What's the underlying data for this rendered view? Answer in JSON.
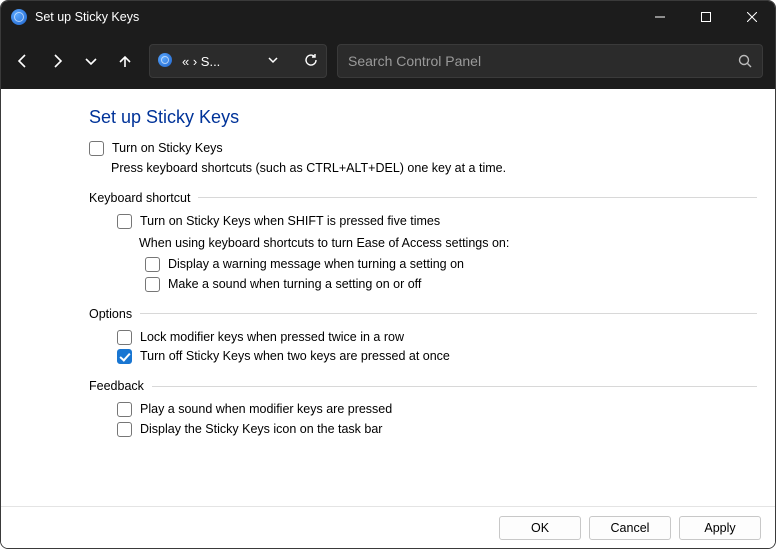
{
  "window": {
    "title": "Set up Sticky Keys"
  },
  "breadcrumb": {
    "trail": "«  ›  S...",
    "chevron_sep": "›"
  },
  "search": {
    "placeholder": "Search Control Panel"
  },
  "page": {
    "heading": "Set up Sticky Keys",
    "turn_on_label": "Turn on Sticky Keys",
    "turn_on_checked": false,
    "turn_on_desc": "Press keyboard shortcuts (such as CTRL+ALT+DEL) one key at a time."
  },
  "groups": {
    "keyboard_shortcut": {
      "title": "Keyboard shortcut",
      "shift5": {
        "label": "Turn on Sticky Keys when SHIFT is pressed five times",
        "checked": false
      },
      "intro": "When using keyboard shortcuts to turn Ease of Access settings on:",
      "warning": {
        "label": "Display a warning message when turning a setting on",
        "checked": false
      },
      "sound": {
        "label": "Make a sound when turning a setting on or off",
        "checked": false
      }
    },
    "options": {
      "title": "Options",
      "lock": {
        "label": "Lock modifier keys when pressed twice in a row",
        "checked": false
      },
      "twokey": {
        "label": "Turn off Sticky Keys when two keys are pressed at once",
        "checked": true
      }
    },
    "feedback": {
      "title": "Feedback",
      "soundmod": {
        "label": "Play a sound when modifier keys are pressed",
        "checked": false
      },
      "taskbar": {
        "label": "Display the Sticky Keys icon on the task bar",
        "checked": false
      }
    }
  },
  "buttons": {
    "ok": "OK",
    "cancel": "Cancel",
    "apply": "Apply"
  }
}
